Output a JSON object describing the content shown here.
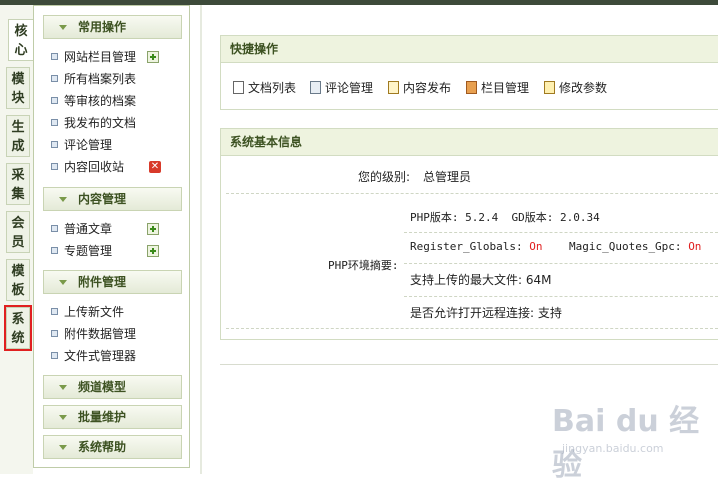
{
  "vtabs": [
    "核心",
    "模块",
    "生成",
    "采集",
    "会员",
    "模板",
    "系统"
  ],
  "sidebar": {
    "sections": [
      {
        "title": "常用操作",
        "items": [
          "网站栏目管理",
          "所有档案列表",
          "等审核的档案",
          "我发布的文档",
          "评论管理",
          "内容回收站"
        ]
      },
      {
        "title": "内容管理",
        "items": [
          "普通文章",
          "专题管理"
        ]
      },
      {
        "title": "附件管理",
        "items": [
          "上传新文件",
          "附件数据管理",
          "文件式管理器"
        ]
      },
      {
        "title": "频道模型"
      },
      {
        "title": "批量维护"
      },
      {
        "title": "系统帮助"
      }
    ]
  },
  "quick": {
    "title": "快捷操作",
    "links": [
      "文档列表",
      "评论管理",
      "内容发布",
      "栏目管理",
      "修改参数"
    ]
  },
  "sysinfo": {
    "title": "系统基本信息",
    "level_label": "您的级别:",
    "level_value": "总管理员",
    "env_label": "PHP环境摘要:",
    "php_label": "PHP版本: 5.2.4",
    "gd_label": "GD版本: 2.0.34",
    "rg_label": "Register_Globals:",
    "rg_value": "On",
    "mq_label": "Magic_Quotes_Gpc:",
    "mq_value": "On",
    "upload_label": "支持上传的最大文件: 64M",
    "remote_label": "是否允许打开远程连接: 支持"
  },
  "watermark": {
    "brand": "Bai du 经验",
    "url": "jingyan.baidu.com"
  }
}
